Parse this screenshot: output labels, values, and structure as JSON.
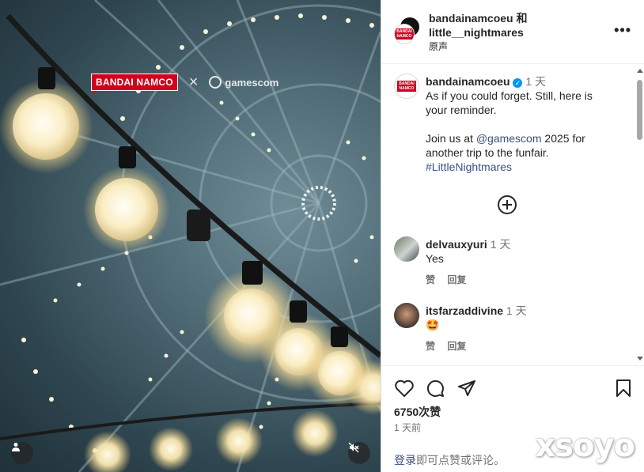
{
  "media": {
    "brand_left": "BANDAI NAMCO",
    "brand_sep": "×",
    "brand_right": "gamescom"
  },
  "header": {
    "author_line1": "bandainamcoeu 和",
    "author_line2": "little__nightmares",
    "audio": "原声",
    "more": "•••"
  },
  "caption": {
    "username": "bandainamcoeu",
    "time": "1 天",
    "line1": "As if you could forget. Still, here is your reminder.",
    "join_prefix": "Join us at ",
    "mention": "@gamescom",
    "join_suffix": " 2025 for another trip to the funfair.",
    "hashtag": "#LittleNightmares"
  },
  "comments": [
    {
      "username": "delvauxyuri",
      "time": "1 天",
      "text": "Yes",
      "like": "赞",
      "reply": "回复"
    },
    {
      "username": "itsfarzaddivine",
      "time": "1 天",
      "text": "🤩",
      "like": "赞",
      "reply": "回复"
    }
  ],
  "footer": {
    "likes": "6750次赞",
    "posted": "1 天前",
    "login": "登录",
    "login_suffix": "即可点赞或评论。"
  },
  "watermark": "xsoyo",
  "icons": [
    "heart-icon",
    "comment-icon",
    "share-icon",
    "bookmark-icon",
    "add-comment-icon",
    "user-tag-icon",
    "mute-icon",
    "more-icon",
    "verified-icon"
  ]
}
